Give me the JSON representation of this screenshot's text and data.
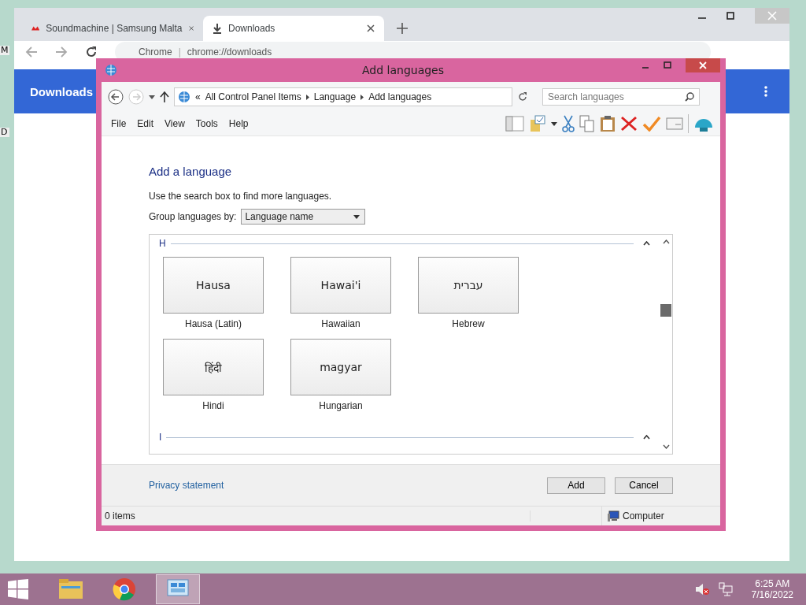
{
  "desktop_labels": [
    "M",
    "D"
  ],
  "browser": {
    "tabs": [
      {
        "title": "Soundmachine | Samsung Malta",
        "selected": false,
        "kind": "site"
      },
      {
        "title": "Downloads",
        "selected": true,
        "kind": "download"
      }
    ],
    "omnibox": {
      "site": "Chrome",
      "separator": "|",
      "url": "chrome://downloads"
    },
    "page_title": "Downloads"
  },
  "dialog": {
    "title": "Add languages",
    "breadcrumb_overflow": "«",
    "breadcrumb": [
      "All Control Panel Items",
      "Language",
      "Add languages"
    ],
    "search": {
      "placeholder": "Search languages"
    },
    "menu": [
      "File",
      "Edit",
      "View",
      "Tools",
      "Help"
    ],
    "heading": "Add a language",
    "hint": "Use the search box to find more languages.",
    "group_by": {
      "label": "Group languages by:",
      "value": "Language name"
    },
    "groups": [
      {
        "letter": "H",
        "expanded": true,
        "languages": [
          {
            "native": "Hausa",
            "name": "Hausa (Latin)"
          },
          {
            "native": "Hawai'i",
            "name": "Hawaiian"
          },
          {
            "native": "עברית",
            "name": "Hebrew"
          },
          {
            "native": "हिंदी",
            "name": "Hindi"
          },
          {
            "native": "magyar",
            "name": "Hungarian"
          }
        ]
      },
      {
        "letter": "I",
        "expanded": true
      }
    ],
    "privacy_link": "Privacy statement",
    "buttons": [
      "Add",
      "Cancel"
    ],
    "status": {
      "items": "0 items",
      "zone": "Computer"
    }
  },
  "taskbar": {
    "apps": [
      {
        "kind": "explorer",
        "selected": false
      },
      {
        "kind": "chrome",
        "selected": false
      },
      {
        "kind": "control-panel",
        "selected": true
      }
    ],
    "time": "6:25 AM",
    "date": "7/16/2022"
  }
}
